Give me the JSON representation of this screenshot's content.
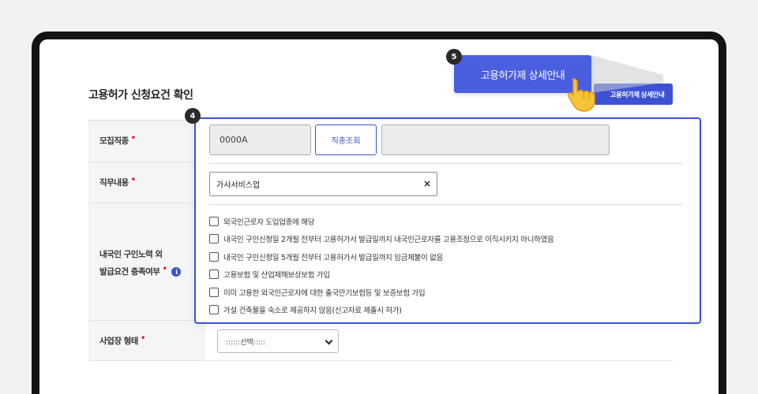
{
  "section": {
    "title": "고용허가 신청요건 확인",
    "detail_button_label": "고용허가제 상세안내"
  },
  "form": {
    "rows": [
      {
        "label": "모집직종",
        "required_mark": "•"
      },
      {
        "label": "직무내용",
        "required_mark": "•"
      },
      {
        "label_line1": "내국인 구인노력 외",
        "label_line2": "발급요건 충족여부",
        "required_mark": "•",
        "info_icon": "i"
      },
      {
        "label": "사업장 형태",
        "required_mark": "•"
      }
    ],
    "job_code_value": "0000A",
    "job_lookup_button": "직종조회",
    "job_name_value": "",
    "duty_value": "가사서비스업",
    "duty_clear": "×",
    "checkboxes": [
      "외국인근로자 도입업종에 해당",
      "내국인 구인신청일 2개월 전부터 고용허가서 발급일까지 내국인근로자를 고용조정으로 이직시키지 아니하였음",
      "내국인 구인신청일 5개월 전부터 고용허가서 발급일까지 임금체불이 없음",
      "고용보험 및 산업재해보상보험 가입",
      "이미 고용한 외국인근로자에 대한 출국만기보험등 및 보증보험 가입",
      "가설 건축물을 숙소로 제공하지 않음(신고자료 제출시 허가)"
    ],
    "workplace_type_selected": "::::::선택:::::"
  },
  "guide": {
    "step4": "4",
    "step5": "5",
    "tooltip_text": "고용허가제 상세안내"
  },
  "colors": {
    "accent": "#3b52d4",
    "tooltip": "#4a5ee0",
    "required": "#e3173a"
  }
}
